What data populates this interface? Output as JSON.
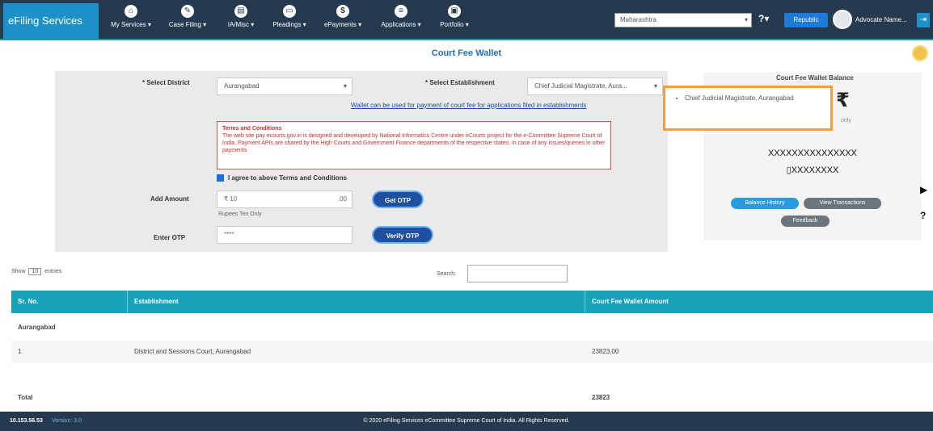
{
  "header": {
    "brand": "eFiling Services",
    "nav": [
      {
        "label": "My Services ▾",
        "icon": "home-icon"
      },
      {
        "label": "Case Filing ▾",
        "icon": "pencil-icon"
      },
      {
        "label": "IA/Misc ▾",
        "icon": "document-icon"
      },
      {
        "label": "Pleadings ▾",
        "icon": "folder-icon"
      },
      {
        "label": "ePayments ▾",
        "icon": "payment-icon"
      },
      {
        "label": "Applications ▾",
        "icon": "file-icon"
      },
      {
        "label": "Portfolio ▾",
        "icon": "briefcase-icon"
      }
    ],
    "state_select": "Maharashtra",
    "help_label": "?▾",
    "blue_button": "Republic",
    "username": "Advocate Name..."
  },
  "page": {
    "title": "Court Fee Wallet"
  },
  "form": {
    "district_label": "* Select District",
    "district_value": "Aurangabad",
    "establishment_label": "* Select Establishment",
    "establishment_value": "Chief Judicial Magistrate, Aura...",
    "wallet_link": "Wallet can be used for payment of court fee for applications filed in establishments",
    "terms_title": "Terms and Conditions",
    "terms_body": "The web site pay ecourts.gov.in is designed and developed by National Informatics Centre under eCourts project for the e-Committee Supreme Court of India. Payment APIs are shared by the High Courts and Government Finance departments of the respective states. In case of any issues/queries in other payments",
    "agree_label": "I agree to above Terms and Conditions",
    "add_amount_label": "Add Amount",
    "amount_prefix": "₹ 10",
    "amount_suffix": ".00",
    "amount_help": "Rupees Ten Only",
    "get_otp": "Get OTP",
    "enter_otp_label": "Enter OTP",
    "otp_value": "****",
    "verify_otp": "Verify OTP"
  },
  "tooltip": {
    "item": "Chief Judicial Magistrate, Aurangabad"
  },
  "wallet_card": {
    "title": "Court Fee Wallet Balance",
    "currency": "₹",
    "subtext": "only",
    "masked_name": "XXXXXXXXXXXXXXX",
    "masked_mobile": "XXXXXXXX",
    "balance_history": "Balance History",
    "view_transactions": "View Transactions",
    "feedback": "Feedback"
  },
  "table": {
    "show_prefix": "Show",
    "show_value": "10",
    "show_suffix": "entries",
    "search_label": "Search:",
    "headers": [
      "Sr. No.",
      "Establishment",
      "Court Fee Wallet Amount"
    ],
    "group": "Aurangabad",
    "row": {
      "sr": "1",
      "establishment": "District and Sessions Court, Aurangabad",
      "amount": "23823.00"
    },
    "total_label": "Total",
    "total_value": "23823"
  },
  "footer": {
    "left": "10.153.56.53",
    "left_extra": "Version: 3.0",
    "center": "© 2020 eFiling Services eCommittee Supreme Court of India. All Rights Reserved."
  }
}
